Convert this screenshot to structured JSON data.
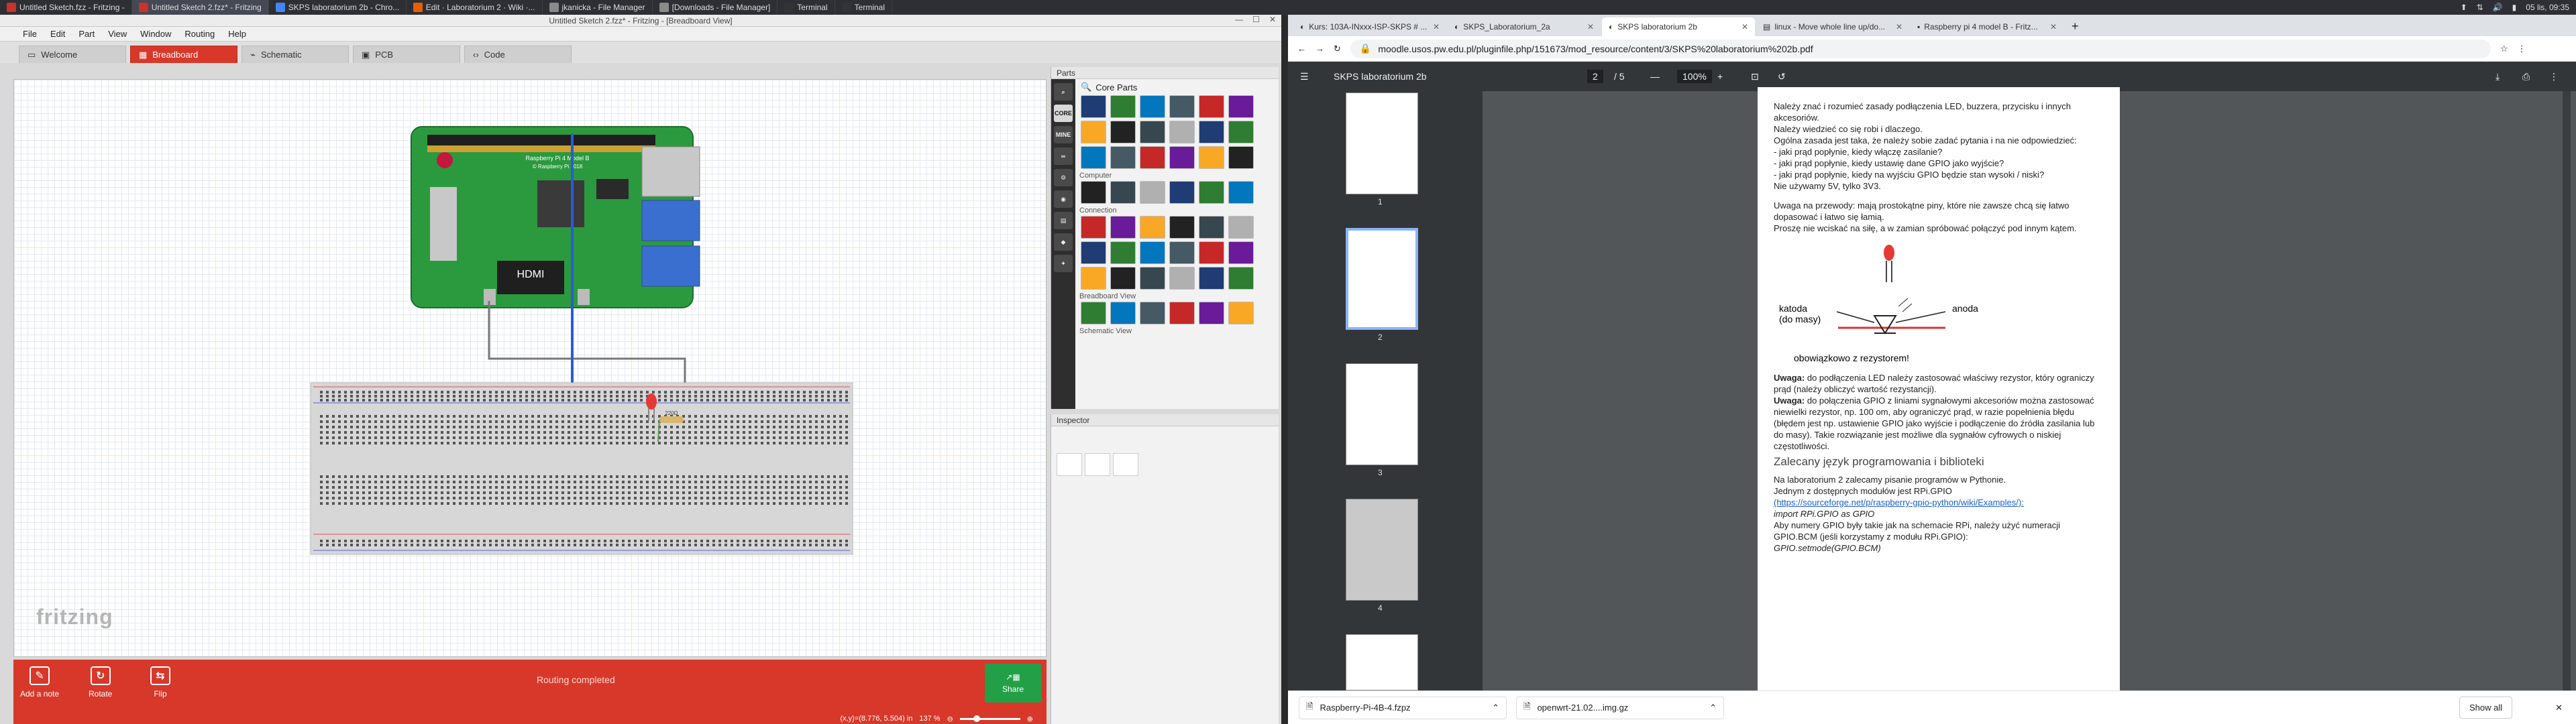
{
  "taskbar": {
    "tasks": [
      {
        "label": "Untitled Sketch.fzz - Fritzing -",
        "color": "#c8332a"
      },
      {
        "label": "Untitled Sketch 2.fzz* - Fritzing",
        "color": "#c8332a"
      },
      {
        "label": "SKPS laboratorium 2b - Chro...",
        "color": "#4285f4"
      },
      {
        "label": "Edit · Laboratorium 2 · Wiki ·...",
        "color": "#e66000"
      },
      {
        "label": "jkanicka - File Manager",
        "color": "#8a8a8a"
      },
      {
        "label": "[Downloads - File Manager]",
        "color": "#8a8a8a"
      },
      {
        "label": "Terminal",
        "color": "#333333"
      },
      {
        "label": "Terminal",
        "color": "#333333"
      }
    ],
    "clock": "05 lis, 09:35"
  },
  "fritzing": {
    "window_title": "Untitled Sketch 2.fzz* - Fritzing - [Breadboard View]",
    "menu": [
      "File",
      "Edit",
      "Part",
      "View",
      "Window",
      "Routing",
      "Help"
    ],
    "tabs": [
      "Welcome",
      "Breadboard",
      "Schematic",
      "PCB",
      "Code"
    ],
    "tab_icons": [
      "welcome-icon",
      "breadboard-icon",
      "schematic-icon",
      "pcb-icon",
      "code-icon"
    ],
    "active_tab": "Breadboard",
    "logo": "fritzing",
    "pi_labels": {
      "model": "Raspberry Pi 4 Model B",
      "copyright": "© Raspberry Pi 2018",
      "hdmi": "HDMI"
    },
    "resistor_label": "220Ω",
    "toolbar": {
      "add_note": "Add a note",
      "rotate": "Rotate",
      "flip": "Flip",
      "routing_status": "Routing completed",
      "share": "Share"
    },
    "status": {
      "coords": "(x,y)=(8.776, 5.504) in",
      "zoom": "137 %"
    },
    "parts_panel": {
      "title": "Parts",
      "bins": [
        "CORE",
        "MINE",
        "🔍"
      ],
      "core_title": "Core Parts",
      "sections": [
        "Computer",
        "Connection",
        "Breadboard View",
        "Schematic View"
      ]
    },
    "inspector_title": "Inspector",
    "colors": {
      "accent": "#d8382a",
      "share": "#23a047",
      "pi_board": "#2b9a3e",
      "wire": "#2a5bd7"
    }
  },
  "chrome": {
    "tabs": [
      {
        "title": "Kurs: 103A-INxxx-ISP-SKPS # ...",
        "active": false
      },
      {
        "title": "SKPS_Laboratorium_2a",
        "active": false
      },
      {
        "title": "SKPS laboratorium 2b",
        "active": true
      },
      {
        "title": "linux - Move whole line up/do...",
        "active": false
      },
      {
        "title": "Raspberry pi 4 model B - Fritz...",
        "active": false
      }
    ],
    "url": "moodle.usos.pw.edu.pl/pluginfile.php/151673/mod_resource/content/3/SKPS%20laboratorium%202b.pdf",
    "pdf": {
      "title": "SKPS laboratorium 2b",
      "page": "2",
      "page_total": "/ 5",
      "zoom": "100%",
      "thumb_pages": [
        "1",
        "2",
        "3",
        "4"
      ],
      "paragraphs": [
        [
          "Należy znać i rozumieć zasady podłączenia LED, buzzera, przycisku i innych akcesoriów.",
          "Należy wiedzieć co się robi i dlaczego.",
          "Ogólna zasada jest taka, że należy sobie zadać pytania i na nie odpowiedzieć:",
          "- jaki prąd popłynie, kiedy włączę zasilanie?",
          "- jaki prąd popłynie, kiedy ustawię dane GPIO jako wyjście?",
          "- jaki prąd popłynie, kiedy na wyjściu GPIO będzie stan wysoki / niski?",
          "Nie używamy 5V, tylko 3V3."
        ],
        [
          "Uwaga na przewody: mają prostokątne piny, które nie zawsze chcą się łatwo dopasować i łatwo się łamią.",
          "Proszę nie wciskać na siłę, a w zamian spróbować połączyć pod innym kątem."
        ]
      ],
      "diagram": {
        "cathode": "katoda",
        "cathode2": "(do masy)",
        "anode": "anoda",
        "note": "obowiązkowo z rezystorem!"
      },
      "warn1_label": "Uwaga:",
      "warn1": " do podłączenia LED należy zastosować właściwy rezystor, który ograniczy prąd (należy obliczyć wartość rezystancji).",
      "warn2_label": "Uwaga:",
      "warn2": " do połączenia GPIO z liniami sygnałowymi akcesoriów można zastosować niewielki rezystor, np. 100 om, aby ograniczyć prąd, w razie popełnienia błędu (błędem jest np. ustawienie GPIO jako wyjście i podłączenie do źródła zasilania lub do masy). Takie rozwiązanie jest możliwe dla sygnałów cyfrowych o niskiej częstotliwości.",
      "heading": "Zalecany język programowania i biblioteki",
      "lang_lines": [
        "Na laboratorium 2 zalecamy pisanie programów w Pythonie.",
        "Jednym z dostępnych modułów jest RPi.GPIO"
      ],
      "link": "(https://sourceforge.net/p/raspberry-gpio-python/wiki/Examples/):",
      "code1": "import RPi.GPIO as GPIO",
      "bcm_line": "Aby numery GPIO były takie jak na schemacie RPi, należy użyć numeracji GPIO.BCM (jeśli korzystamy z modułu RPi.GPIO):",
      "code2": "GPIO.setmode(GPIO.BCM)"
    },
    "downloads": [
      "Raspberry-Pi-4B-4.fzpz",
      "openwrt-21.02....img.gz"
    ],
    "show_all": "Show all"
  }
}
